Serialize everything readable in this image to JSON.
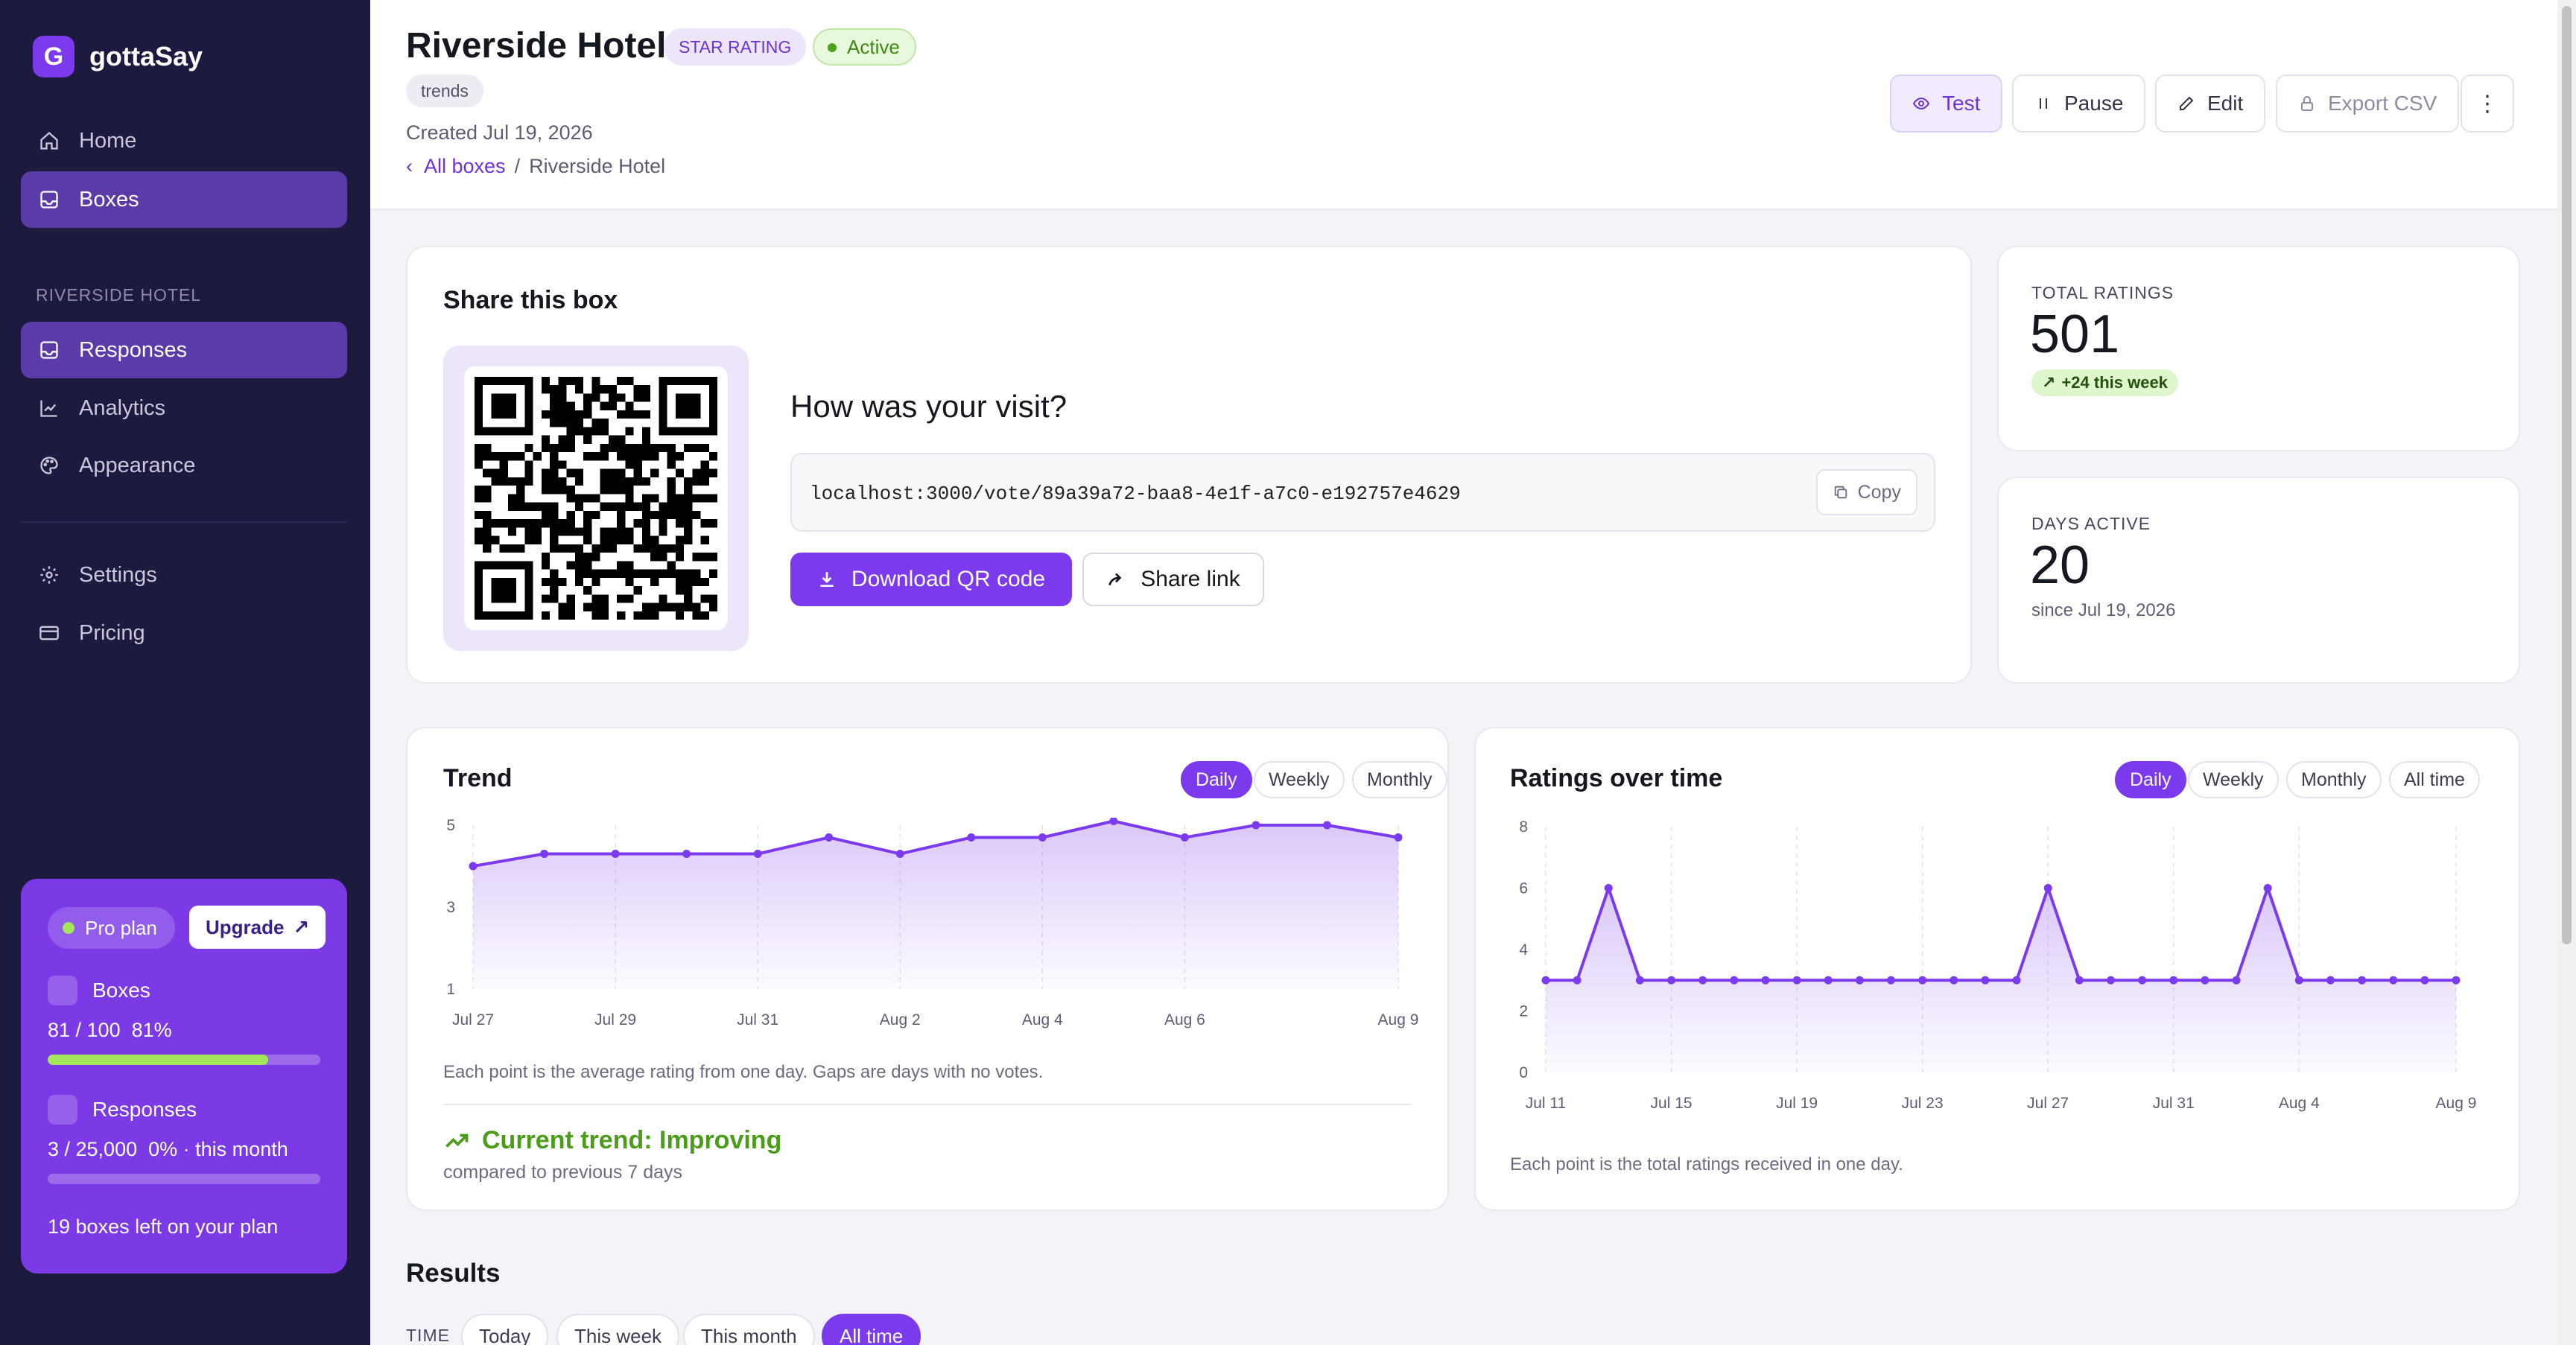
{
  "brand": {
    "logo_letter": "G",
    "name": "gottaSay"
  },
  "sidebar": {
    "top_items": [
      {
        "label": "Home",
        "icon": "home-icon"
      },
      {
        "label": "Boxes",
        "icon": "inbox-icon"
      }
    ],
    "section_title": "RIVERSIDE HOTEL",
    "section_items": [
      {
        "label": "Responses",
        "icon": "inbox-icon"
      },
      {
        "label": "Analytics",
        "icon": "chart-icon"
      },
      {
        "label": "Appearance",
        "icon": "palette-icon"
      }
    ],
    "bottom_items": [
      {
        "label": "Settings",
        "icon": "gear-icon"
      },
      {
        "label": "Pricing",
        "icon": "card-icon"
      }
    ]
  },
  "plan": {
    "plan_name": "Pro plan",
    "upgrade_label": "Upgrade",
    "boxes_title": "Boxes",
    "boxes_usage": "81 / 100",
    "boxes_percent": "81%",
    "boxes_fraction": 0.81,
    "responses_title": "Responses",
    "responses_usage": "3 / 25,000",
    "responses_percent": "0%",
    "responses_period": "· this month",
    "responses_fraction": 0.0,
    "boxes_left": "19 boxes left on your plan"
  },
  "header": {
    "title": "Riverside Hotel",
    "type_badge": "STAR RATING",
    "status_badge": "Active",
    "tag": "trends",
    "created": "Created Jul 19, 2026",
    "breadcrumb_link": "All boxes",
    "breadcrumb_sep": "/",
    "breadcrumb_current": "Riverside Hotel",
    "buttons": {
      "test": "Test",
      "pause": "Pause",
      "edit": "Edit",
      "export": "Export CSV"
    }
  },
  "share": {
    "title": "Share this box",
    "question": "How was your visit?",
    "url": "localhost:3000/vote/89a39a72-baa8-4e1f-a7c0-e192757e4629",
    "copy_label": "Copy",
    "download_label": "Download QR code",
    "share_label": "Share link"
  },
  "stats": {
    "total_label": "TOTAL RATINGS",
    "total_value": "501",
    "total_delta": "+24 this week",
    "days_label": "DAYS ACTIVE",
    "days_value": "20",
    "days_since": "since Jul 19, 2026"
  },
  "trend": {
    "title": "Trend",
    "tabs": [
      "Daily",
      "Weekly",
      "Monthly"
    ],
    "active_tab": "Daily",
    "note": "Each point is the average rating from one day. Gaps are days with no votes.",
    "current": "Current trend: Improving",
    "compared": "compared to previous 7 days"
  },
  "ratings_over_time": {
    "title": "Ratings over time",
    "tabs": [
      "Daily",
      "Weekly",
      "Monthly",
      "All time"
    ],
    "active_tab": "Daily",
    "note": "Each point is the total ratings received in one day."
  },
  "results": {
    "title": "Results",
    "time_label": "TIME",
    "time_filters": [
      "Today",
      "This week",
      "This month",
      "All time"
    ],
    "active_filter": "All time"
  },
  "colors": {
    "accent": "#7c3aed",
    "sidebar_bg": "#1d1a3f",
    "success": "#4a9c19"
  },
  "chart_data": [
    {
      "type": "area",
      "title": "Trend",
      "x": [
        "Jul 27",
        "Jul 28",
        "Jul 29",
        "Jul 30",
        "Jul 31",
        "Aug 1",
        "Aug 2",
        "Aug 3",
        "Aug 4",
        "Aug 5",
        "Aug 6",
        "Aug 7",
        "Aug 8",
        "Aug 9"
      ],
      "x_tick_labels": [
        "Jul 27",
        "Jul 29",
        "Jul 31",
        "Aug 2",
        "Aug 4",
        "Aug 6",
        "Aug 9"
      ],
      "y_tick_labels": [
        "5",
        "3",
        "1"
      ],
      "values": [
        4.0,
        4.3,
        4.3,
        4.3,
        4.3,
        4.7,
        4.3,
        4.7,
        4.7,
        5.1,
        4.7,
        5.0,
        5.0,
        4.7
      ],
      "ylim": [
        1,
        5
      ],
      "grid": "vertical dashed"
    },
    {
      "type": "area",
      "title": "Ratings over time",
      "x": [
        "Jul 11",
        "Jul 12",
        "Jul 13",
        "Jul 14",
        "Jul 15",
        "Jul 16",
        "Jul 17",
        "Jul 18",
        "Jul 19",
        "Jul 20",
        "Jul 21",
        "Jul 22",
        "Jul 23",
        "Jul 24",
        "Jul 25",
        "Jul 26",
        "Jul 27",
        "Jul 28",
        "Jul 29",
        "Jul 30",
        "Jul 31",
        "Aug 1",
        "Aug 2",
        "Aug 3",
        "Aug 4",
        "Aug 5",
        "Aug 6",
        "Aug 7",
        "Aug 8",
        "Aug 9"
      ],
      "x_tick_labels": [
        "Jul 11",
        "Jul 15",
        "Jul 19",
        "Jul 23",
        "Jul 27",
        "Jul 31",
        "Aug 4",
        "Aug 9"
      ],
      "y_tick_labels": [
        "8",
        "6",
        "4",
        "2",
        "0"
      ],
      "values": [
        3,
        3,
        6,
        3,
        3,
        3,
        3,
        3,
        3,
        3,
        3,
        3,
        3,
        3,
        3,
        3,
        6,
        3,
        3,
        3,
        3,
        3,
        3,
        6,
        3,
        3,
        3,
        3,
        3,
        3
      ],
      "ylim": [
        0,
        8
      ],
      "grid": "vertical dashed"
    }
  ]
}
